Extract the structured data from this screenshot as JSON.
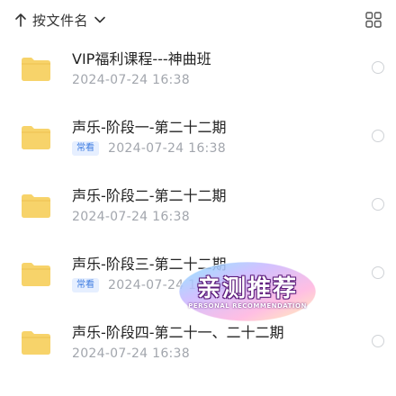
{
  "toolbar": {
    "sort_label": "按文件名",
    "sort_arrow_icon": "arrow-up-icon",
    "sort_chevron_icon": "chevron-down-icon",
    "view_toggle_icon": "grid-view-icon"
  },
  "files": [
    {
      "name": "VIP福利课程---神曲班",
      "date": "2024-07-24  16:38",
      "badge": "",
      "icon": "folder-icon"
    },
    {
      "name": "声乐-阶段一-第二十二期",
      "date": "2024-07-24  16:38",
      "badge": "常看",
      "icon": "folder-icon"
    },
    {
      "name": "声乐-阶段二-第二十二期",
      "date": "2024-07-24  16:38",
      "badge": "",
      "icon": "folder-icon"
    },
    {
      "name": "声乐-阶段三-第二十二期",
      "date": "2024-07-24  16:38",
      "badge": "常看",
      "icon": "folder-icon"
    },
    {
      "name": "声乐-阶段四-第二十一、二十二期",
      "date": "2024-07-24  16:38",
      "badge": "",
      "icon": "folder-icon"
    }
  ],
  "overlay": {
    "title": "亲测推荐",
    "subtitle": "PERSONAL RECOMMENDATION"
  },
  "colors": {
    "folder": "#f7d36a",
    "badge_text": "#3d7be0",
    "date_text": "#a2a6ad"
  }
}
